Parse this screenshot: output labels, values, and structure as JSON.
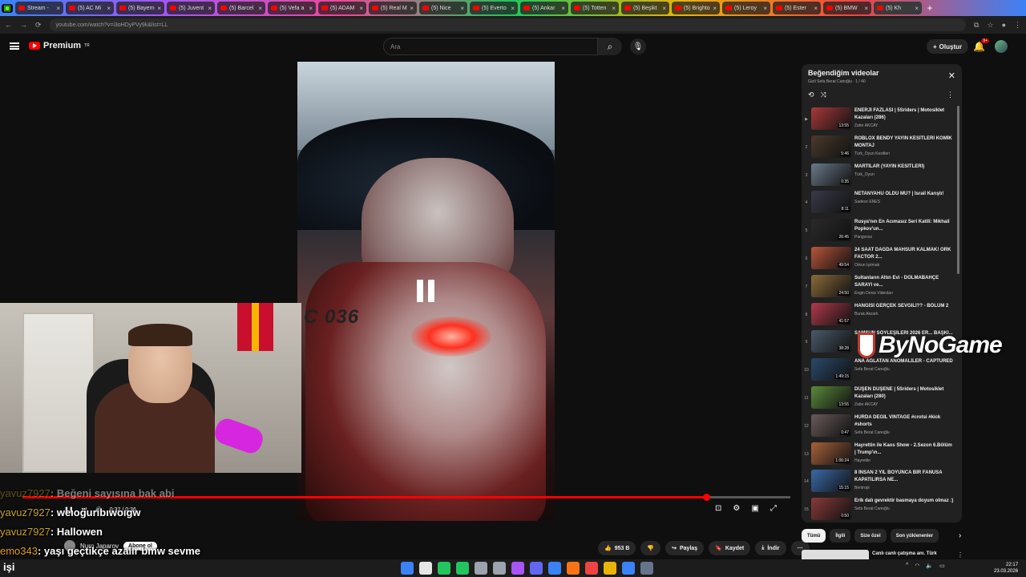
{
  "browser": {
    "tabs": [
      {
        "label": "Stream -",
        "active": false
      },
      {
        "label": "(5) AC Mi",
        "active": false
      },
      {
        "label": "(5) Bayern",
        "active": false
      },
      {
        "label": "(5) Juvent",
        "active": false
      },
      {
        "label": "(5) Barcel",
        "active": false
      },
      {
        "label": "(5) Vefa a",
        "active": false
      },
      {
        "label": "(5) ADAM",
        "active": false
      },
      {
        "label": "(5) Real M",
        "active": false
      },
      {
        "label": "(5) Nice",
        "active": false
      },
      {
        "label": "(5) Everto",
        "active": false
      },
      {
        "label": "(5) Ankar",
        "active": false
      },
      {
        "label": "(5) Totten",
        "active": false
      },
      {
        "label": "(5) Beşikt",
        "active": false
      },
      {
        "label": "(5) Brighto",
        "active": false
      },
      {
        "label": "(5) Leroy",
        "active": false
      },
      {
        "label": "(5) Ester",
        "active": false
      },
      {
        "label": "(5) BMW",
        "active": false
      },
      {
        "label": "(5) Kh",
        "active": true
      }
    ],
    "url": "youtube.com/watch?v=i3oHDyPVy9k&list=LL"
  },
  "youtube": {
    "logo": "Premium",
    "logo_sup": "TR",
    "search_placeholder": "Ara",
    "create_label": "Oluştur",
    "notif_count": "9+"
  },
  "player": {
    "time": "0:32 / 0:36",
    "progress": 0.89,
    "plate_text": "C 036"
  },
  "channel": {
    "name": "Nuro Japarov",
    "subscribe": "Abone ol"
  },
  "actions": [
    {
      "label": "953 B",
      "icon": "like-icon"
    },
    {
      "label": "",
      "icon": "dislike-icon"
    },
    {
      "label": "Paylaş",
      "icon": "share-icon"
    },
    {
      "label": "Kaydet",
      "icon": "save-icon"
    },
    {
      "label": "İndir",
      "icon": "download-icon"
    }
  ],
  "chat": [
    {
      "user": "yavuz7927",
      "msg": ": Beğeni sayısına bak abi",
      "faded": true
    },
    {
      "user": "yavuz7927",
      "msg": ": weıoguribıwoıgw",
      "faded": false
    },
    {
      "user": "yavuz7927",
      "msg": ": Hallowen",
      "faded": false
    },
    {
      "user": "emo343",
      "msg": ": yaşı geçtikçe azalır bmw sevme",
      "faded": false
    }
  ],
  "playlist": {
    "title": "Beğendiğim videolar",
    "subtitle": "Gizli  Sefa Berat Canoğlu  ·  1 / 40",
    "items": [
      {
        "idx": "▶",
        "title": "ENERJİ FAZLASI | 5Sriders | Motosiklet Kazaları (286)",
        "channel": "Zafer AKCAY",
        "dur": "13:55",
        "color": "#a83a3a"
      },
      {
        "idx": "2",
        "title": "ROBLOX BENDY YAYIN KESİTLERİ KOMİK MONTAJ",
        "channel": "Türk_Oyun Kesitleri",
        "dur": "5:46",
        "color": "#4a3a2a"
      },
      {
        "idx": "3",
        "title": "MARTILAR (YAYIN KESİTLERİ)",
        "channel": "Türk_Oyun",
        "dur": "0:35",
        "color": "#6a7a8a"
      },
      {
        "idx": "4",
        "title": "NETANYAHU ÖLDÜ MÜ? | İsrail Karıştı!",
        "channel": "Sadece ENES",
        "dur": "8:11",
        "color": "#3a3a4a"
      },
      {
        "idx": "5",
        "title": "Rusya'nın En Acımasız Seri Katili: Mikhail Popkov'un...",
        "channel": "Pangvoss",
        "dur": "26:45",
        "color": "#2a2a2a"
      },
      {
        "idx": "6",
        "title": "24 SAAT DAĞDA MAHSUR KALMAK! ORK FACTOR 2...",
        "channel": "Orkun Işıtmak",
        "dur": "49:54",
        "color": "#b8553a"
      },
      {
        "idx": "7",
        "title": "Sultanların Altın Evi - DOLMABAHÇE SARAYI ve...",
        "channel": "Engin Deniz Videoları",
        "dur": "24:50",
        "color": "#8a6a3a"
      },
      {
        "idx": "8",
        "title": "HANGİSİ GERÇEK SEVGİLİ?? - BÖLÜM 2",
        "channel": "Burak Aksürk",
        "dur": "41:57",
        "color": "#b03a4a"
      },
      {
        "idx": "9",
        "title": "SAMSUN SÖYLEŞİLERİ 2026 ER... BAŞKI...",
        "channel": "",
        "dur": "38:28",
        "color": "#4a5a6a"
      },
      {
        "idx": "10",
        "title": "ANA AĞLATAN ANOMALİLER - CAPTURED",
        "channel": "Sefa Berat Canoğlu",
        "dur": "1:49:15",
        "color": "#2a4a6a"
      },
      {
        "idx": "11",
        "title": "DÜŞEN DÜŞENE | 5Sriders | Motosiklet Kazaları (280)",
        "channel": "Zafer AKCAY",
        "dur": "13:55",
        "color": "#5a8a3a"
      },
      {
        "idx": "12",
        "title": "HURDA DEĞİL VINTAGE #crotsi #kick #shorts",
        "channel": "Sefa Berat Canoğlu",
        "dur": "0:47",
        "color": "#6a5a5a"
      },
      {
        "idx": "13",
        "title": "Hayrettin ile Kaos Show - 2.Sezon 6.Bölüm | Trump'ın...",
        "channel": "Hayrettin",
        "dur": "1:06:24",
        "color": "#a8623a"
      },
      {
        "idx": "14",
        "title": "8 İNSAN 2 YIL BOYUNCA BİR FANUSA KAPATILIRSA NE...",
        "channel": "Bentropi",
        "dur": "15:15",
        "color": "#3a6aa8"
      },
      {
        "idx": "15",
        "title": "Erik dalı gevrektir basmaya doyum olmaz :)",
        "channel": "Sefa Berat Canoğlu",
        "dur": "0:50",
        "color": "#8a3a3a"
      }
    ]
  },
  "chips": [
    "Tümü",
    "İlgili",
    "Size özel",
    "Son yüklenenler"
  ],
  "recommendation": {
    "title": "Canlı canlı çatışma anı. Türk"
  },
  "watermark": "ByNoGame",
  "taskbar": {
    "left_text": "işi",
    "time": "22:17",
    "date": "23.03.2026",
    "icon_colors": [
      "#3b82f6",
      "#e5e5e5",
      "#22c55e",
      "#22c55e",
      "#9ca3af",
      "#9ca3af",
      "#a855f7",
      "#6366f1",
      "#3b82f6",
      "#f97316",
      "#ef4444",
      "#eab308",
      "#3b82f6",
      "#64748b"
    ]
  }
}
